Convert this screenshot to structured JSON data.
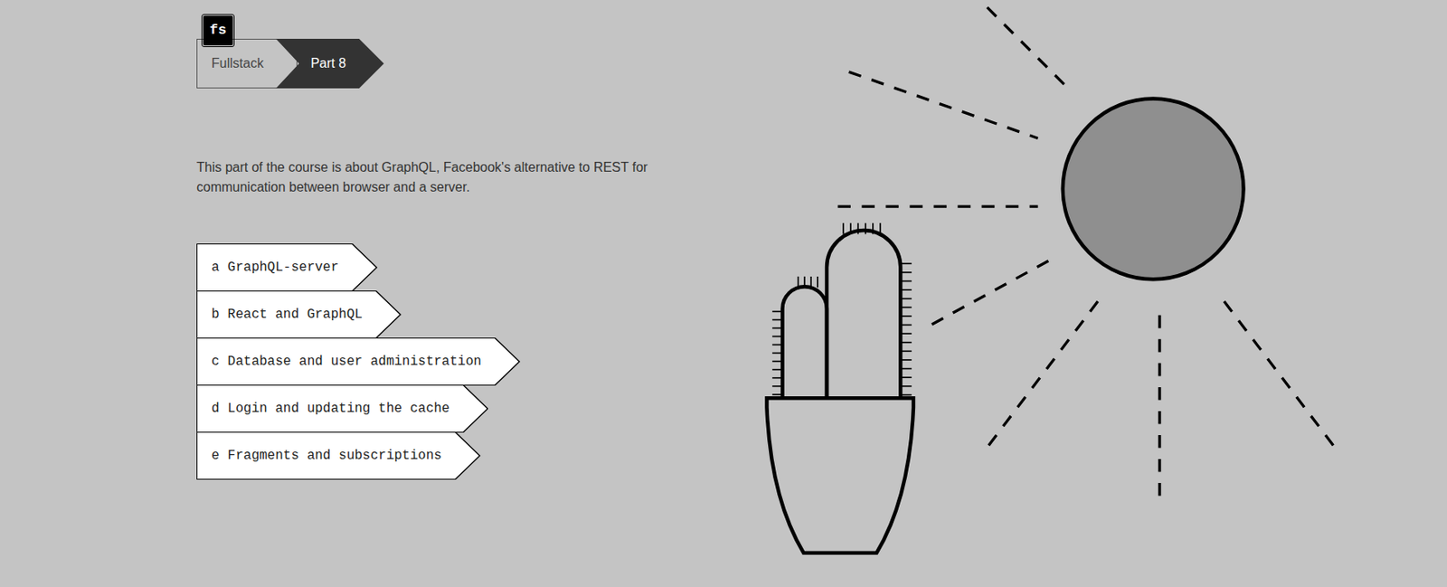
{
  "logo": {
    "text": "fs"
  },
  "breadcrumb": [
    {
      "label": "Fullstack",
      "selected": false
    },
    {
      "label": "Part 8",
      "selected": true
    }
  ],
  "description": "This part of the course is about GraphQL, Facebook's alternative to REST for communication between browser and a server.",
  "sections": [
    {
      "letter": "a",
      "title": "GraphQL-server"
    },
    {
      "letter": "b",
      "title": "React and GraphQL"
    },
    {
      "letter": "c",
      "title": "Database and user administration"
    },
    {
      "letter": "d",
      "title": "Login and updating the cache"
    },
    {
      "letter": "e",
      "title": "Fragments and subscriptions"
    }
  ]
}
